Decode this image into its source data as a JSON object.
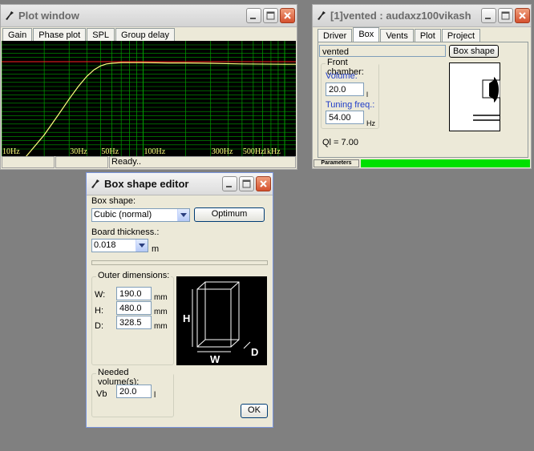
{
  "plot_window": {
    "title": "Plot window",
    "tabs": [
      "Gain",
      "Phase plot",
      "SPL",
      "Group delay"
    ],
    "x_ticks": [
      "10Hz",
      "30Hz",
      "50Hz",
      "100Hz",
      "300Hz",
      "500Hz",
      "1kHz"
    ],
    "status": [
      "",
      "",
      "Ready.."
    ],
    "colors": {
      "background": "#000000",
      "grid": "#00A000",
      "curve": "#FFFF7F",
      "reference": "#FF2020"
    }
  },
  "chart_data": {
    "type": "line",
    "title": "",
    "xlabel": "",
    "ylabel": "",
    "x_scale": "log",
    "xlim": [
      10,
      1200
    ],
    "x_ticks": [
      10,
      30,
      50,
      100,
      300,
      500,
      1000
    ],
    "series": [
      {
        "x": [
          14,
          20,
          25,
          30,
          35,
          40,
          45,
          50,
          55,
          60,
          70,
          80,
          100,
          150,
          200,
          300,
          500,
          1000,
          1200
        ],
        "y": [
          -30,
          -22,
          -16,
          -11,
          -7,
          -4,
          -2,
          -0.8,
          -0.2,
          0,
          0.2,
          0.2,
          0.2,
          0.1,
          0.1,
          0,
          -0.2,
          -0.3,
          -0.3
        ]
      }
    ]
  },
  "box_window": {
    "title": "[1]vented : audaxz100vikash",
    "tabs": [
      "Driver",
      "Box",
      "Vents",
      "Plot",
      "Project"
    ],
    "box_type": "vented",
    "box_shape_button": "Box shape",
    "front_chamber": {
      "legend": "Front chamber:",
      "volume_label": "Volume:",
      "volume_value": "20.0",
      "volume_unit": "l",
      "tuning_label": "Tuning freq.:",
      "tuning_value": "54.00",
      "tuning_unit": "Hz"
    },
    "ql": "Ql = 7.00",
    "status_label": "Parameters",
    "progress": 1.0,
    "progress_color": "#00E000"
  },
  "shape_editor": {
    "title": "Box shape editor",
    "box_shape_label": "Box shape:",
    "box_shape_value": "Cubic (normal)",
    "optimum_button": "Optimum",
    "thickness_label": "Board thickness.:",
    "thickness_value": "0.018",
    "thickness_unit": "m",
    "outer_legend": "Outer dimensions:",
    "dims": [
      {
        "label": "W:",
        "value": "190.0",
        "unit": "mm"
      },
      {
        "label": "H:",
        "value": "480.0",
        "unit": "mm"
      },
      {
        "label": "D:",
        "value": "328.5",
        "unit": "mm"
      }
    ],
    "diagram_labels": {
      "h": "H",
      "w": "W",
      "d": "D"
    },
    "needed_legend": "Needed volume(s):",
    "vb_label": "Vb",
    "vb_value": "20.0",
    "vb_unit": "l",
    "ok_button": "OK"
  }
}
